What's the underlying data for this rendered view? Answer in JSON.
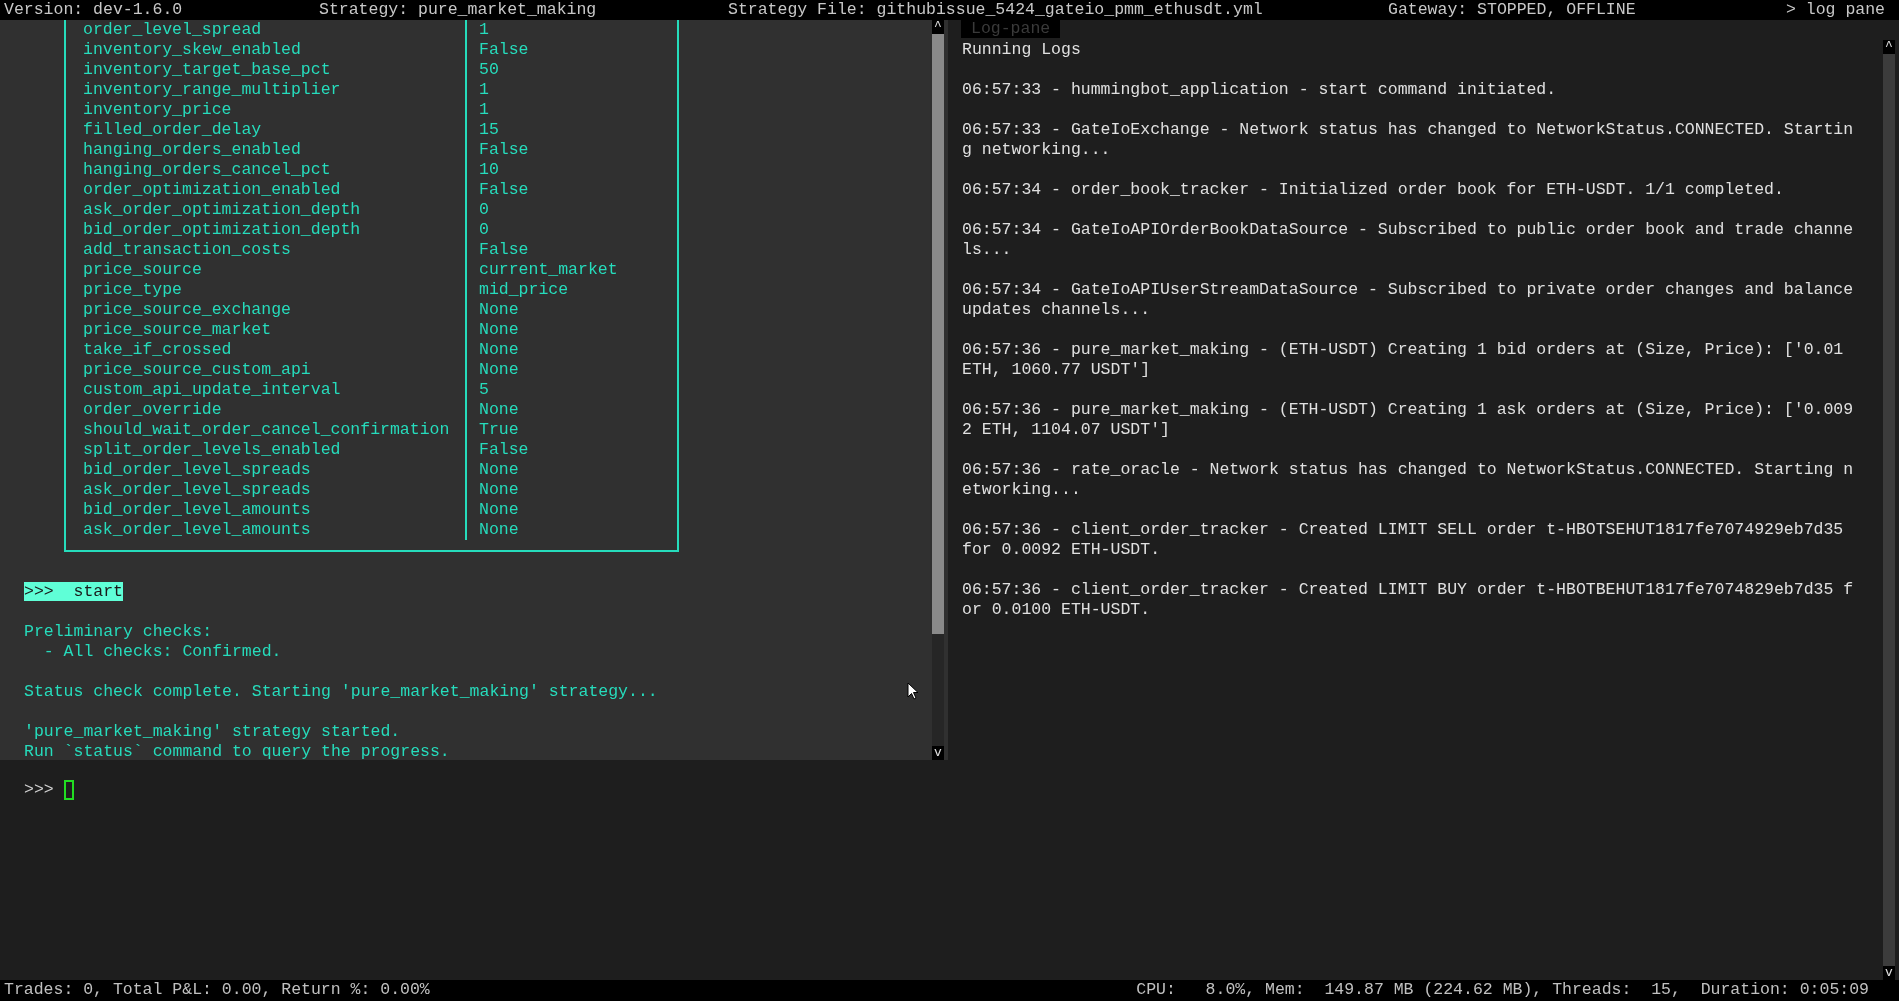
{
  "top_bar": {
    "items": [
      "Version: dev-1.6.0",
      "Strategy: pure_market_making",
      "Strategy File: githubissue_5424_gateio_pmm_ethusdt.yml",
      "Gateway: STOPPED, OFFLINE"
    ],
    "toggle": "> log pane"
  },
  "output_pane": {
    "config_rows": [
      {
        "name": "order_level_spread",
        "value": "1"
      },
      {
        "name": "inventory_skew_enabled",
        "value": "False"
      },
      {
        "name": "inventory_target_base_pct",
        "value": "50"
      },
      {
        "name": "inventory_range_multiplier",
        "value": "1"
      },
      {
        "name": "inventory_price",
        "value": "1"
      },
      {
        "name": "filled_order_delay",
        "value": "15"
      },
      {
        "name": "hanging_orders_enabled",
        "value": "False"
      },
      {
        "name": "hanging_orders_cancel_pct",
        "value": "10"
      },
      {
        "name": "order_optimization_enabled",
        "value": "False"
      },
      {
        "name": "ask_order_optimization_depth",
        "value": "0"
      },
      {
        "name": "bid_order_optimization_depth",
        "value": "0"
      },
      {
        "name": "add_transaction_costs",
        "value": "False"
      },
      {
        "name": "price_source",
        "value": "current_market"
      },
      {
        "name": "price_type",
        "value": "mid_price"
      },
      {
        "name": "price_source_exchange",
        "value": "None"
      },
      {
        "name": "price_source_market",
        "value": "None"
      },
      {
        "name": "take_if_crossed",
        "value": "None"
      },
      {
        "name": "price_source_custom_api",
        "value": "None"
      },
      {
        "name": "custom_api_update_interval",
        "value": "5"
      },
      {
        "name": "order_override",
        "value": "None"
      },
      {
        "name": "should_wait_order_cancel_confirmation",
        "value": "True"
      },
      {
        "name": "split_order_levels_enabled",
        "value": "False"
      },
      {
        "name": "bid_order_level_spreads",
        "value": "None"
      },
      {
        "name": "ask_order_level_spreads",
        "value": "None"
      },
      {
        "name": "bid_order_level_amounts",
        "value": "None"
      },
      {
        "name": "ask_order_level_amounts",
        "value": "None"
      }
    ],
    "entered_command": ">>>  start",
    "messages": [
      {
        "lines": [
          "Preliminary checks:",
          "  - All checks: Confirmed."
        ]
      },
      {
        "lines": [
          "Status check complete. Starting 'pure_market_making' strategy..."
        ]
      },
      {
        "lines": [
          "'pure_market_making' strategy started.",
          "Run `status` command to query the progress."
        ]
      }
    ],
    "scroll_up": "^",
    "scroll_down": "v"
  },
  "input": {
    "prompt": ">>>"
  },
  "log_pane": {
    "label": "Log-pane",
    "title": "Running Logs",
    "scroll_up": "^",
    "scroll_down": "v",
    "entries": [
      "06:57:33 - hummingbot_application - start command initiated.",
      "06:57:33 - GateIoExchange - Network status has changed to NetworkStatus.CONNECTED. Starting networking...",
      "06:57:34 - order_book_tracker - Initialized order book for ETH-USDT. 1/1 completed.",
      "06:57:34 - GateIoAPIOrderBookDataSource - Subscribed to public order book and trade channels...",
      "06:57:34 - GateIoAPIUserStreamDataSource - Subscribed to private order changes and balance updates channels...",
      "06:57:36 - pure_market_making - (ETH-USDT) Creating 1 bid orders at (Size, Price): ['0.01 ETH, 1060.77 USDT']",
      "06:57:36 - pure_market_making - (ETH-USDT) Creating 1 ask orders at (Size, Price): ['0.0092 ETH, 1104.07 USDT']",
      "06:57:36 - rate_oracle - Network status has changed to NetworkStatus.CONNECTED. Starting networking...",
      "06:57:36 - client_order_tracker - Created LIMIT SELL order t-HBOTSEHUT1817fe7074929eb7d35 for 0.0092 ETH-USDT.",
      "06:57:36 - client_order_tracker - Created LIMIT BUY order t-HBOTBEHUT1817fe7074829eb7d35 for 0.0100 ETH-USDT."
    ]
  },
  "status_bar": {
    "left": "Trades: 0, Total P&L: 0.00, Return %: 0.00%",
    "right": "CPU:   8.0%, Mem:  149.87 MB (224.62 MB), Threads:  15,  Duration: 0:05:09"
  }
}
